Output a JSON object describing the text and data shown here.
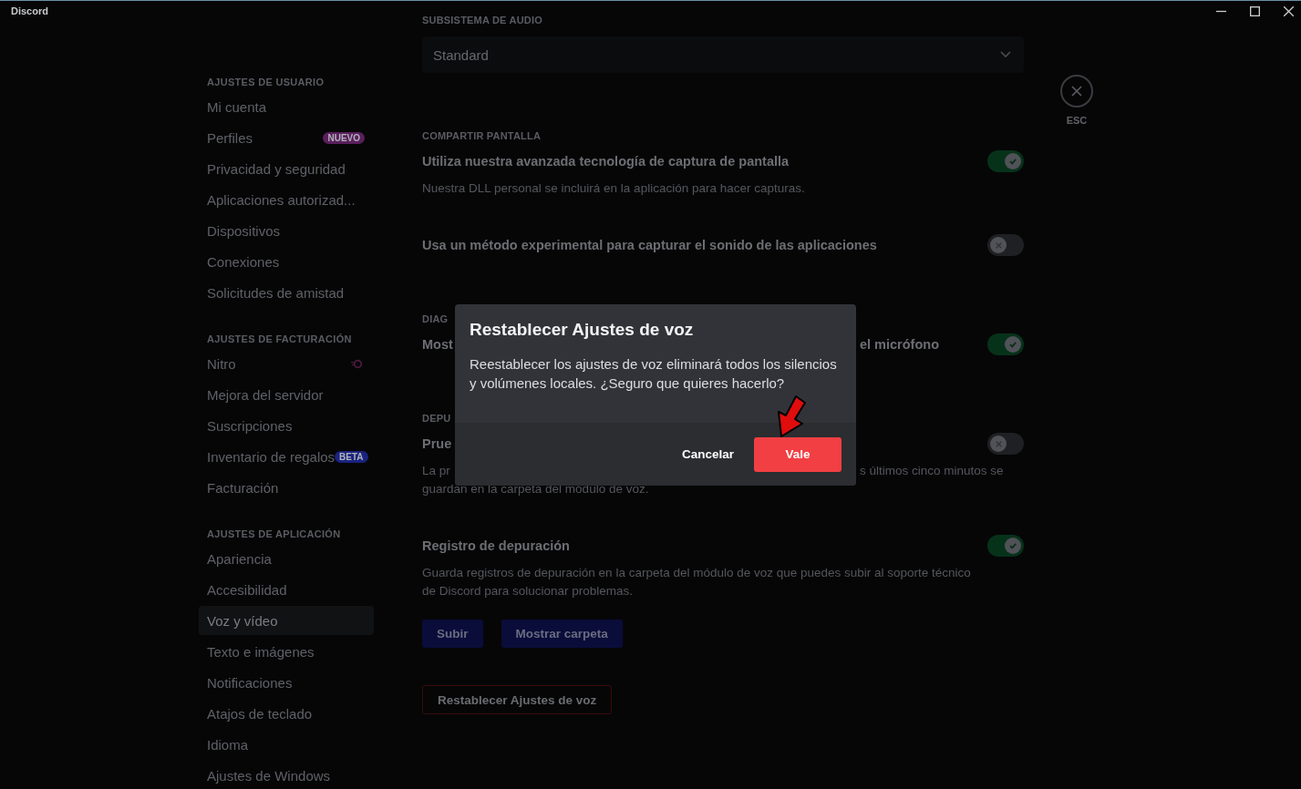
{
  "window": {
    "title": "Discord"
  },
  "sidebar": {
    "sections": [
      {
        "heading": "AJUSTES DE USUARIO",
        "items": [
          {
            "label": "Mi cuenta",
            "kind": "plain",
            "selected": false
          },
          {
            "label": "Perfiles",
            "kind": "badge",
            "badge": "NUEVO",
            "color": "#5a1f5c",
            "selected": false
          },
          {
            "label": "Privacidad y seguridad",
            "kind": "plain",
            "selected": false
          },
          {
            "label": "Aplicaciones autorizad...",
            "kind": "plain",
            "selected": false
          },
          {
            "label": "Dispositivos",
            "kind": "plain",
            "selected": false
          },
          {
            "label": "Conexiones",
            "kind": "plain",
            "selected": false
          },
          {
            "label": "Solicitudes de amistad",
            "kind": "plain",
            "selected": false
          }
        ]
      },
      {
        "heading": "AJUSTES DE FACTURACIÓN",
        "items": [
          {
            "label": "Nitro",
            "kind": "nitro",
            "selected": false
          },
          {
            "label": "Mejora del servidor",
            "kind": "plain",
            "selected": false
          },
          {
            "label": "Suscripciones",
            "kind": "plain",
            "selected": false
          },
          {
            "label": "Inventario de regalos",
            "kind": "badge",
            "badge": "BETA",
            "color": "#1a237e",
            "selected": false
          },
          {
            "label": "Facturación",
            "kind": "plain",
            "selected": false
          }
        ]
      },
      {
        "heading": "AJUSTES DE APLICACIÓN",
        "items": [
          {
            "label": "Apariencia",
            "kind": "plain",
            "selected": false
          },
          {
            "label": "Accesibilidad",
            "kind": "plain",
            "selected": false
          },
          {
            "label": "Voz y vídeo",
            "kind": "plain",
            "selected": true
          },
          {
            "label": "Texto e imágenes",
            "kind": "plain",
            "selected": false
          },
          {
            "label": "Notificaciones",
            "kind": "plain",
            "selected": false
          },
          {
            "label": "Atajos de teclado",
            "kind": "plain",
            "selected": false
          },
          {
            "label": "Idioma",
            "kind": "plain",
            "selected": false
          },
          {
            "label": "Ajustes de Windows",
            "kind": "plain",
            "selected": false
          }
        ]
      }
    ]
  },
  "settings": [
    {
      "kind": "heading",
      "text": "SUBSISTEMA DE AUDIO"
    },
    {
      "kind": "dropdown",
      "value": "Standard"
    },
    {
      "kind": "heading",
      "text": "COMPARTIR PANTALLA"
    },
    {
      "kind": "toggle",
      "title": "Utiliza nuestra avanzada tecnología de captura de pantalla",
      "description": "Nuestra DLL personal se incluirá en la aplicación para hacer capturas.",
      "on": true
    },
    {
      "kind": "toggle",
      "title": "Usa un método experimental para capturar el sonido de las aplicaciones",
      "on": false
    },
    {
      "kind": "heading",
      "text": "DIAG"
    },
    {
      "kind": "toggle",
      "title": "Most",
      "title_right": "el micrófono",
      "on": true
    },
    {
      "kind": "heading",
      "text": "DEPU"
    },
    {
      "kind": "toggle",
      "title": "Prue",
      "description": "La pr",
      "description_right": "s últimos cinco minutos se",
      "description_more": "guardan en la carpeta del módulo de voz.",
      "on": false
    },
    {
      "kind": "toggle",
      "title": "Registro de depuración",
      "description": "Guarda registros de depuración en la carpeta del módulo de voz que puedes subir al soporte técnico de Discord para solucionar problemas.",
      "on": true
    },
    {
      "kind": "buttons",
      "buttons": [
        "Subir",
        "Mostrar carpeta"
      ]
    },
    {
      "kind": "danger",
      "label": "Restablecer Ajustes de voz"
    }
  ],
  "close": {
    "label": "ESC"
  },
  "dialog": {
    "title": "Restablecer Ajustes de voz",
    "message": "Reestablecer los ajustes de voz eliminará todos los silencios y volúmenes locales. ¿Seguro que quieres hacerlo?",
    "cancel": "Cancelar",
    "confirm": "Vale"
  }
}
